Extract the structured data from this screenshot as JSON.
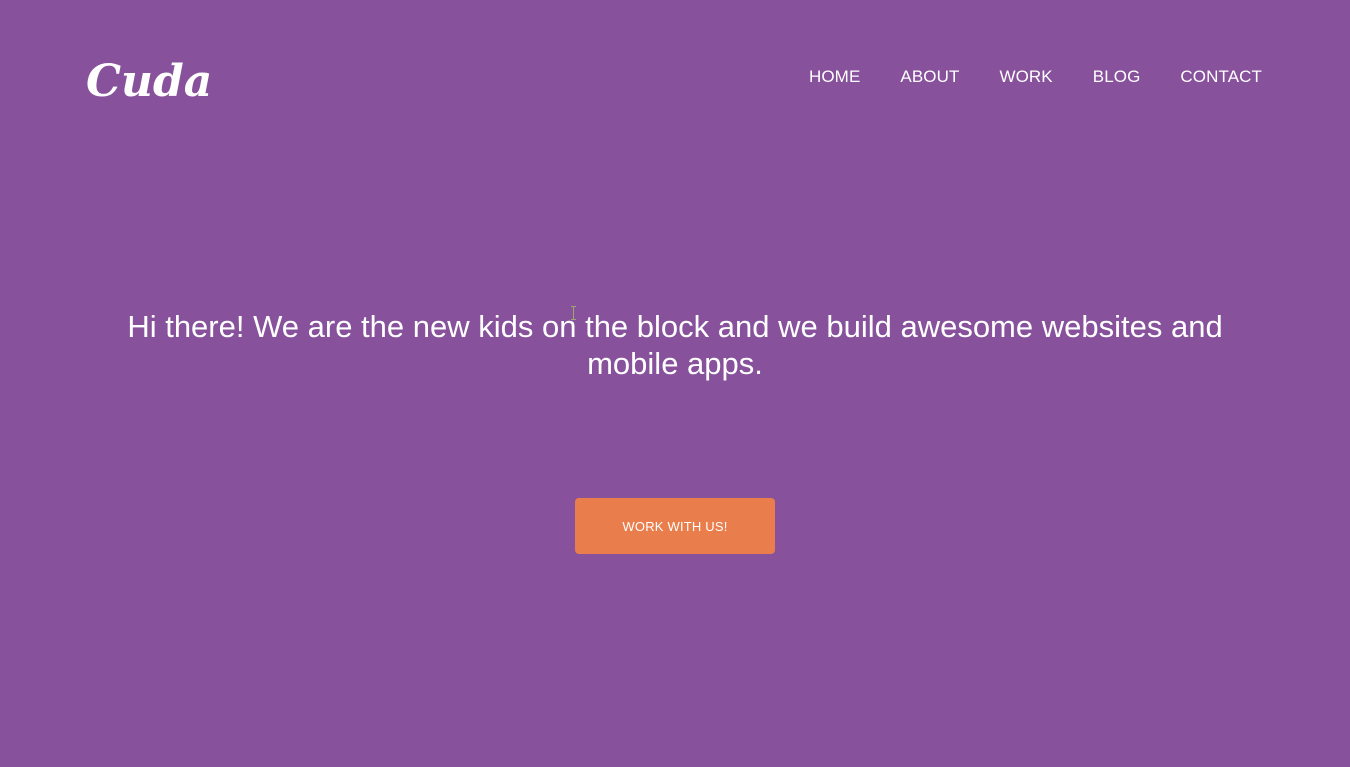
{
  "brand": {
    "name": "Cuda",
    "background_color": "#87519c",
    "accent_color": "#e97d4b"
  },
  "nav": {
    "items": [
      {
        "label": "HOME"
      },
      {
        "label": "ABOUT"
      },
      {
        "label": "WORK"
      },
      {
        "label": "BLOG"
      },
      {
        "label": "CONTACT"
      }
    ]
  },
  "hero": {
    "headline": "Hi there! We are the new kids on the block and we build awesome websites and mobile apps.",
    "cta_label": "WORK WITH US!"
  },
  "icons": {
    "cursor": "text-cursor-icon"
  }
}
